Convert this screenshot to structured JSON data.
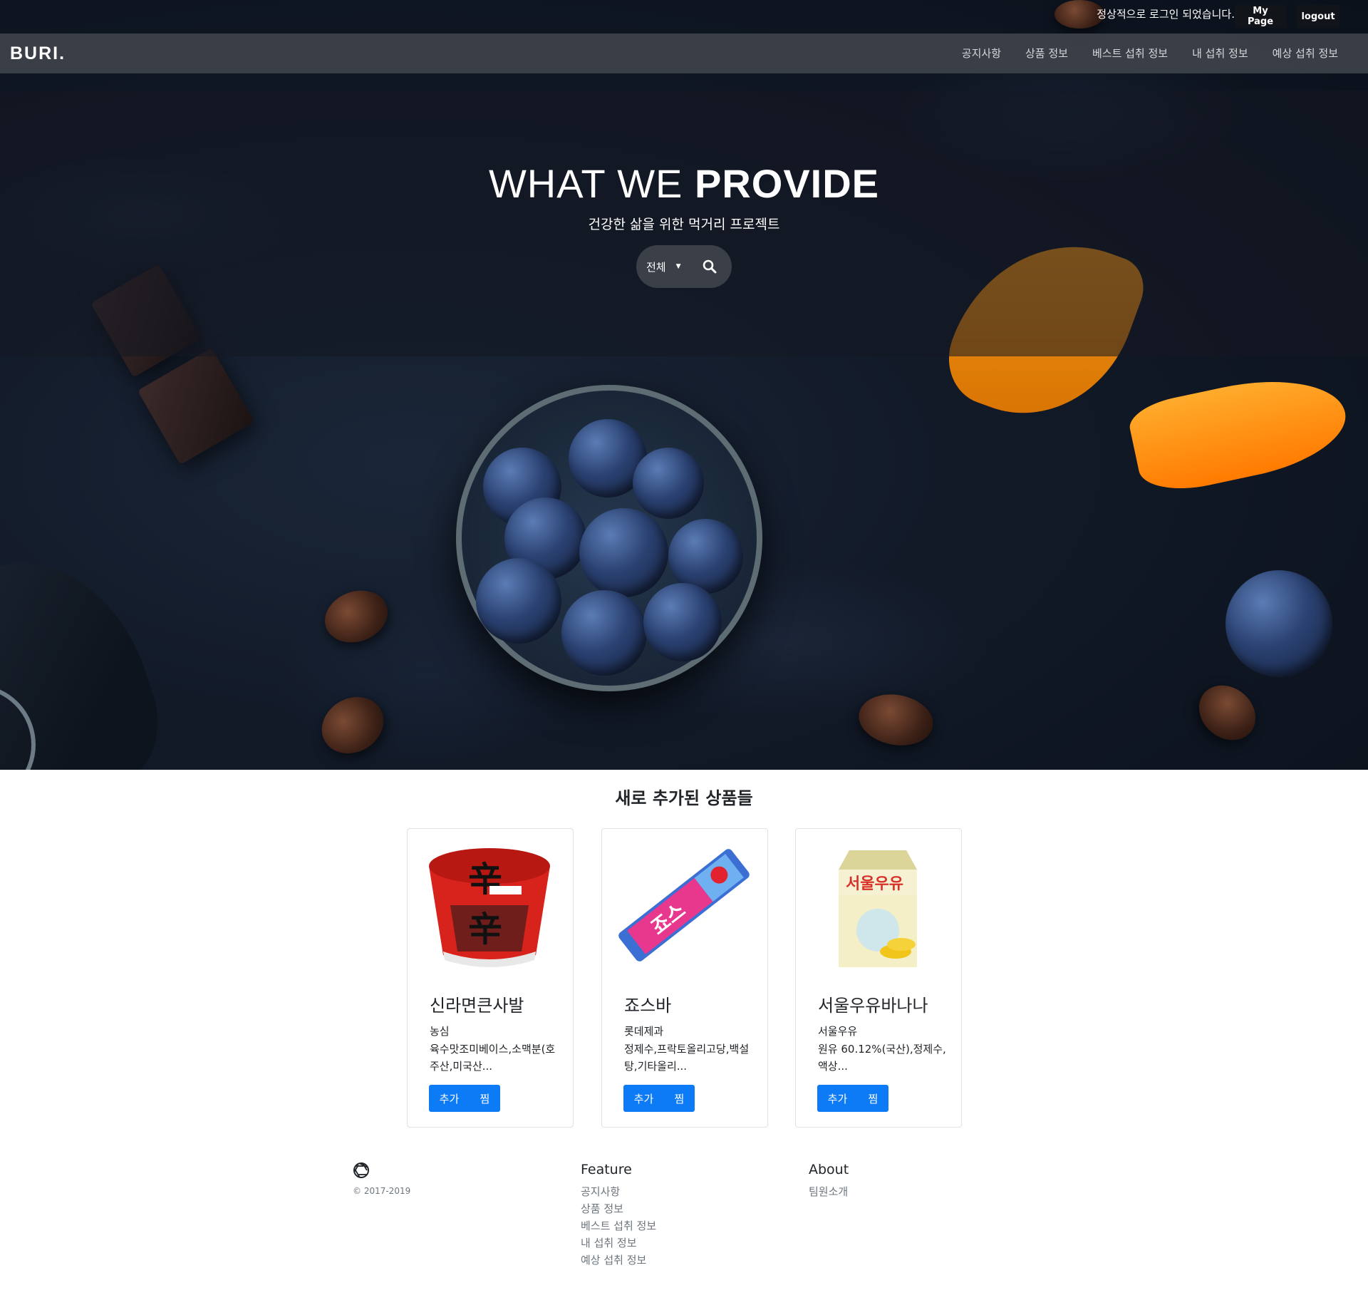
{
  "topbar": {
    "login_message": "정상적으로 로그인 되었습니다.",
    "mypage_label": "My Page",
    "logout_label": "logout"
  },
  "navbar": {
    "brand": "BURI.",
    "items": [
      {
        "label": "공지사항"
      },
      {
        "label": "상품 정보"
      },
      {
        "label": "베스트 섭취 정보"
      },
      {
        "label": "내 섭취 정보"
      },
      {
        "label": "예상 섭취 정보"
      }
    ]
  },
  "hero": {
    "title_light": "WHAT WE ",
    "title_bold": "PROVIDE",
    "subtitle": "건강한 삶을 위한 먹거리 프로젝트",
    "search_select_value": "전체",
    "search_icon": "search-icon"
  },
  "products": {
    "section_title": "새로 추가된 상품들",
    "items": [
      {
        "name": "신라면큰사발",
        "maker": "농심",
        "description": "육수맛조미베이스,소맥분(호주산,미국산...",
        "add_label": "추가",
        "wish_label": "찜"
      },
      {
        "name": "죠스바",
        "maker": "롯데제과",
        "description": "정제수,프락토올리고당,백설탕,기타올리...",
        "add_label": "추가",
        "wish_label": "찜"
      },
      {
        "name": "서울우유바나나",
        "maker": "서울우유",
        "description": "원유 60.12%(국산),정제수,액상...",
        "add_label": "추가",
        "wish_label": "찜"
      }
    ]
  },
  "footer": {
    "logo_icon": "aperture-icon",
    "copyright": "© 2017-2019",
    "feature_title": "Feature",
    "feature_links": [
      "공지사항",
      "상품 정보",
      "베스트 섭취 정보",
      "내 섭취 정보",
      "예상 섭취 정보"
    ],
    "about_title": "About",
    "about_links": [
      "팀원소개"
    ]
  },
  "colors": {
    "accent": "#0d7bf5",
    "navbar_bg": "#3e424a",
    "hero_bg": "#121a28"
  }
}
